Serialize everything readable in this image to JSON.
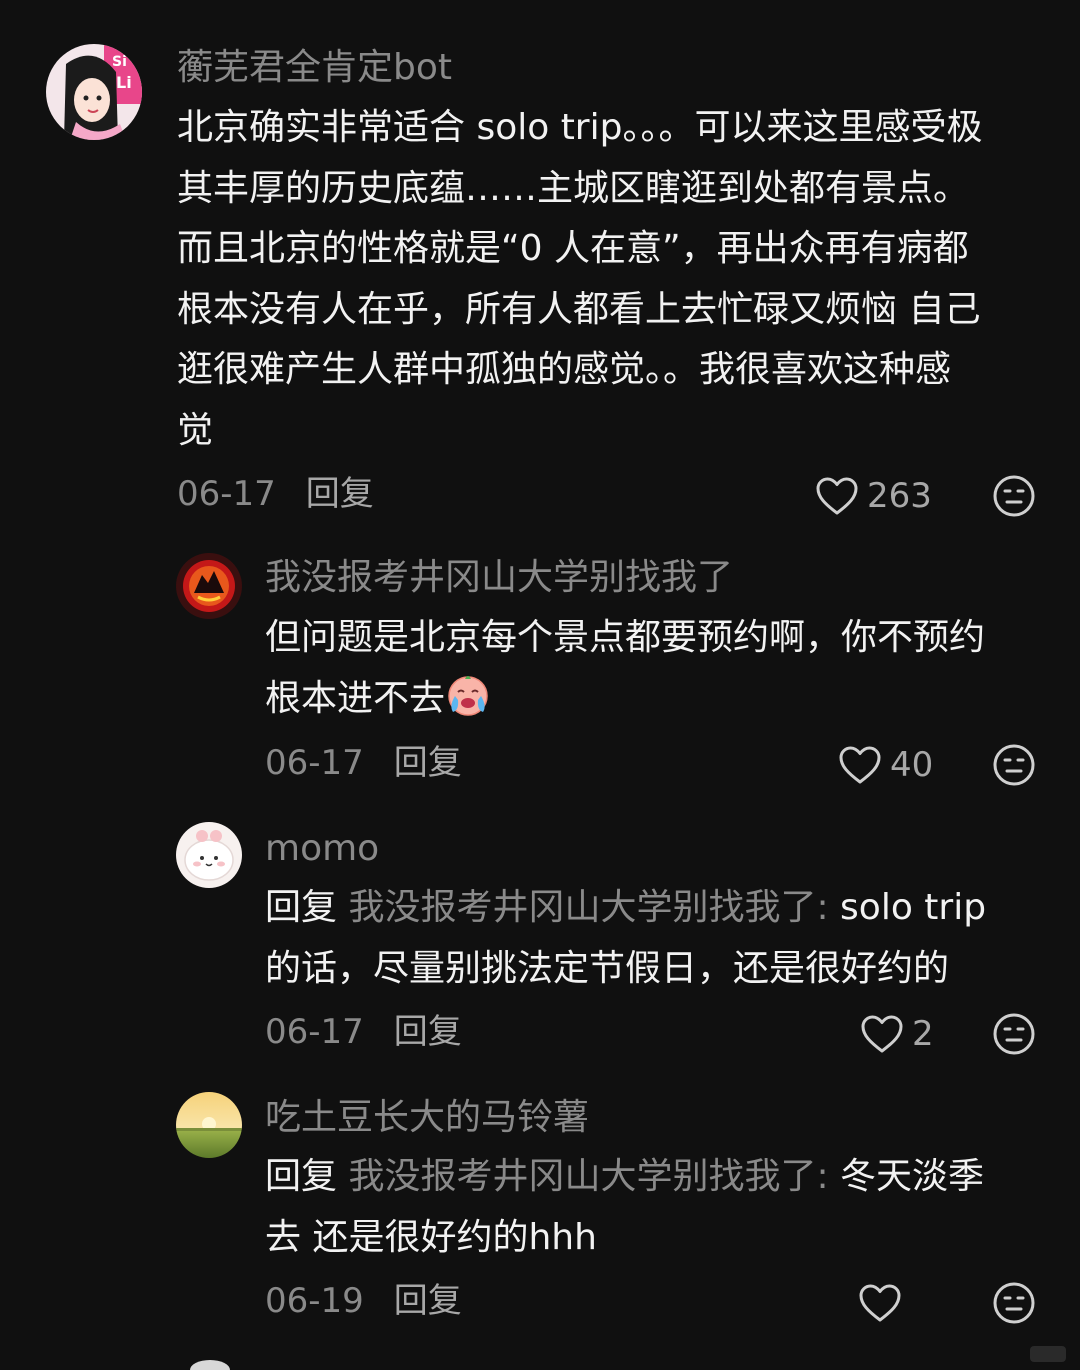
{
  "comments": [
    {
      "username": "蘅芜君全肯定bot",
      "lines": [
        "北京确实非常适合 solo trip。。。可以来这里感受极",
        "其丰厚的历史底蕴……主城区瞎逛到处都有景点。",
        "而且北京的性格就是“0 人在意”，再出众再有病都",
        "根本没有人在乎，所有人都看上去忙碌又烦恼 自己",
        "逛很难产生人群中孤独的感觉。。我很喜欢这种感",
        "觉"
      ],
      "date": "06-17",
      "reply_label": "回复",
      "likes": "263"
    },
    {
      "username": "我没报考井冈山大学别找我了",
      "lines": [
        "但问题是北京每个景点都要预约啊，你不预约",
        "根本进不去"
      ],
      "date": "06-17",
      "reply_label": "回复",
      "likes": "40"
    },
    {
      "username": "momo",
      "reply_prefix": "回复",
      "reply_target": "我没报考井冈山大学别找我了:",
      "first_line_rest": " solo trip",
      "lines": [
        "的话，尽量别挑法定节假日，还是很好约的"
      ],
      "date": "06-17",
      "reply_label": "回复",
      "likes": "2"
    },
    {
      "username": "吃土豆长大的马铃薯",
      "reply_prefix": "回复",
      "reply_target": "我没报考井冈山大学别找我了:",
      "first_line_rest": " 冬天淡季",
      "lines": [
        "去 还是很好约的hhh"
      ],
      "date": "06-19",
      "reply_label": "回复",
      "likes": ""
    }
  ],
  "icons": {
    "like": "heart-outline-icon",
    "dislike": "neutral-face-icon",
    "emoji": "crying-face-emoji"
  },
  "watermark": "小红书"
}
